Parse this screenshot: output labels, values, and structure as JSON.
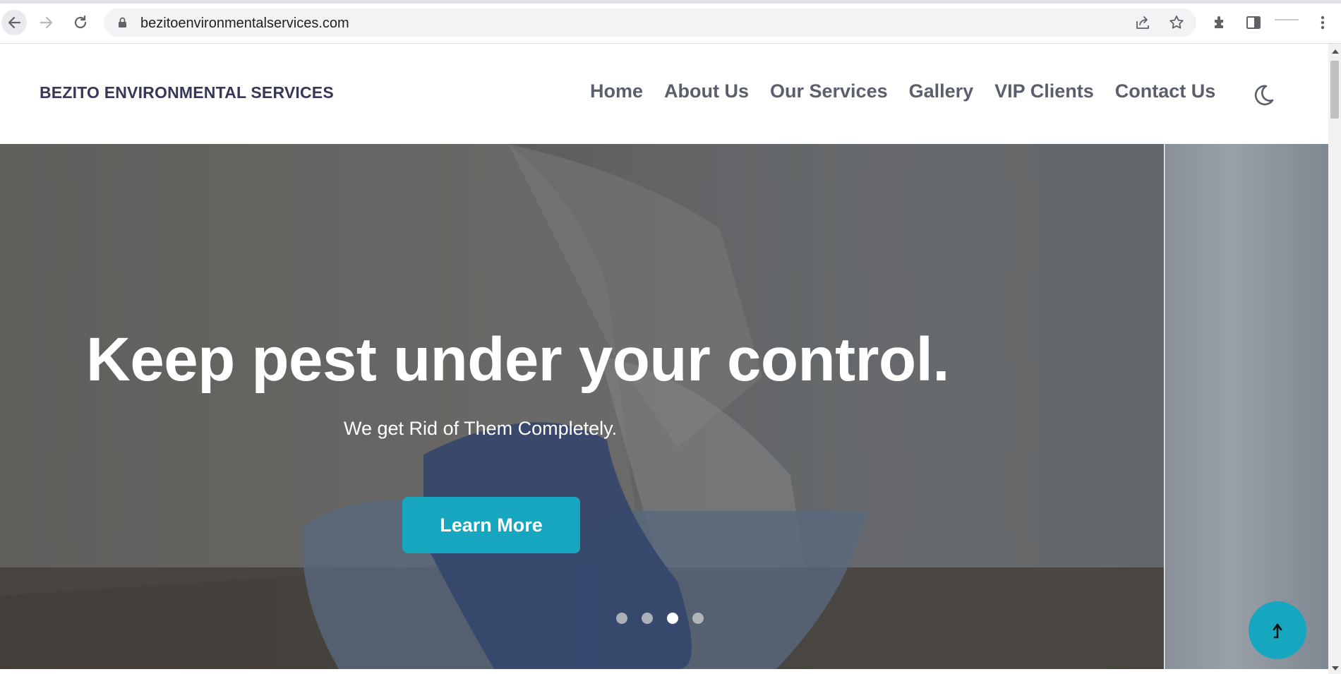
{
  "browser": {
    "url": "bezitoenvironmentalservices.com",
    "icons": [
      "back-arrow-icon",
      "forward-arrow-icon",
      "reload-icon",
      "lock-icon",
      "share-icon",
      "star-icon",
      "extensions-icon",
      "side-panel-icon",
      "menu-icon"
    ]
  },
  "header": {
    "brand": "BEZITO ENVIRONMENTAL SERVICES",
    "nav": [
      "Home",
      "About Us",
      "Our Services",
      "Gallery",
      "VIP Clients",
      "Contact Us"
    ],
    "theme_toggle_icon": "moon-icon"
  },
  "hero": {
    "title": "Keep pest under your control.",
    "subtitle": "We get Rid of Them Completely.",
    "cta": "Learn More",
    "slides_total": 4,
    "active_slide": 3
  },
  "colors": {
    "accent": "#17a6bf",
    "brand_text": "#37375a",
    "nav_text": "#5b5f6b"
  },
  "scroll_to_top_icon": "arrow-up-icon"
}
